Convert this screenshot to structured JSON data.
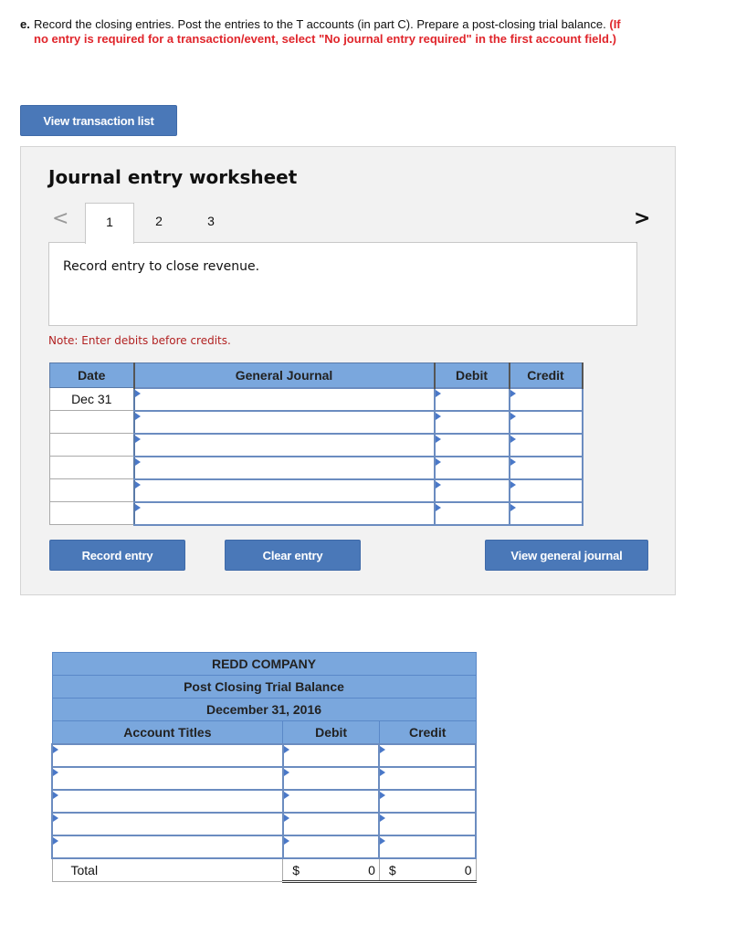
{
  "instructions": {
    "prefix": "e.",
    "text": "Record the closing entries. Post the entries to the T accounts (in part C). Prepare a post-closing trial balance.",
    "red_note": "(If no entry is required for a transaction/event, select \"No journal entry required\" in the first account field.)"
  },
  "buttons": {
    "view_transaction_list": "View transaction list",
    "record_entry": "Record entry",
    "clear_entry": "Clear entry",
    "view_general_journal": "View general journal"
  },
  "worksheet": {
    "title": "Journal entry worksheet",
    "nav_prev": "<",
    "nav_next": ">",
    "tabs": [
      {
        "label": "1",
        "active": true
      },
      {
        "label": "2",
        "active": false
      },
      {
        "label": "3",
        "active": false
      }
    ],
    "prompt": "Record entry to close revenue.",
    "note": "Note: Enter debits before credits.",
    "table": {
      "headers": {
        "date": "Date",
        "general_journal": "General Journal",
        "debit": "Debit",
        "credit": "Credit"
      },
      "rows": [
        {
          "date": "Dec 31",
          "account": "",
          "debit": "",
          "credit": ""
        },
        {
          "date": "",
          "account": "",
          "debit": "",
          "credit": ""
        },
        {
          "date": "",
          "account": "",
          "debit": "",
          "credit": ""
        },
        {
          "date": "",
          "account": "",
          "debit": "",
          "credit": ""
        },
        {
          "date": "",
          "account": "",
          "debit": "",
          "credit": ""
        },
        {
          "date": "",
          "account": "",
          "debit": "",
          "credit": ""
        }
      ]
    }
  },
  "trial_balance": {
    "company": "REDD COMPANY",
    "title": "Post Closing Trial Balance",
    "date": "December 31, 2016",
    "headers": {
      "account_titles": "Account Titles",
      "debit": "Debit",
      "credit": "Credit"
    },
    "rows": [
      {
        "account": "",
        "debit": "",
        "credit": ""
      },
      {
        "account": "",
        "debit": "",
        "credit": ""
      },
      {
        "account": "",
        "debit": "",
        "credit": ""
      },
      {
        "account": "",
        "debit": "",
        "credit": ""
      },
      {
        "account": "",
        "debit": "",
        "credit": ""
      }
    ],
    "total": {
      "label": "Total",
      "debit_currency": "$",
      "debit_value": "0",
      "credit_currency": "$",
      "credit_value": "0"
    }
  }
}
